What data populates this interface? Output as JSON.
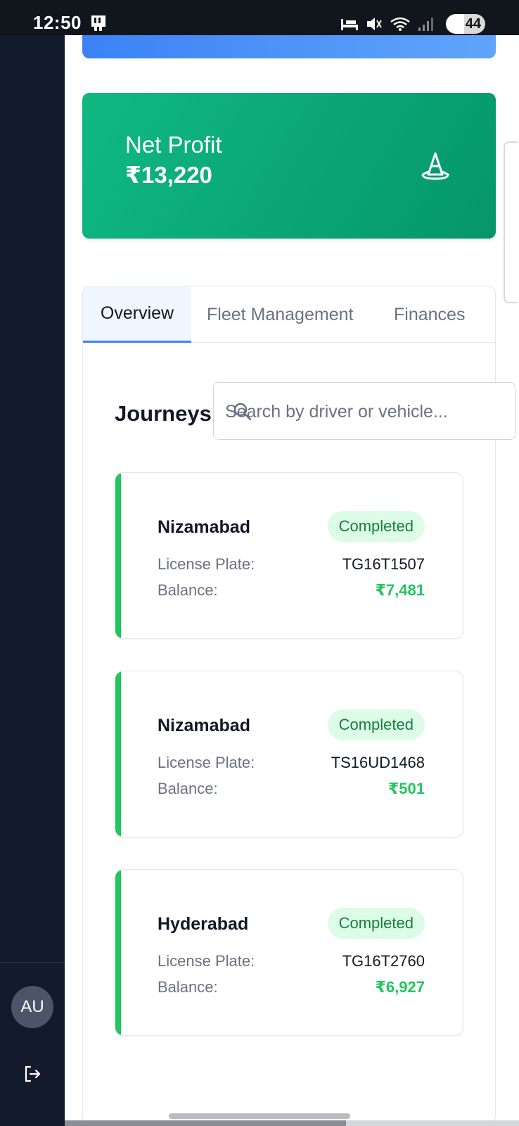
{
  "status_bar": {
    "time": "12:50",
    "battery": "44"
  },
  "sidebar": {
    "avatar_initials": "AU"
  },
  "summary": {
    "net_profit_label": "Net Profit",
    "net_profit_value": "₹13,220"
  },
  "tabs": [
    {
      "label": "Overview",
      "active": true
    },
    {
      "label": "Fleet Management",
      "active": false
    },
    {
      "label": "Finances",
      "active": false
    }
  ],
  "journeys": {
    "title": "Journeys",
    "search_placeholder": "Search by driver or vehicle...",
    "license_label": "License Plate:",
    "balance_label": "Balance:",
    "items": [
      {
        "city": "Nizamabad",
        "status": "Completed",
        "plate": "TG16T1507",
        "balance": "₹7,481"
      },
      {
        "city": "Nizamabad",
        "status": "Completed",
        "plate": "TS16UD1468",
        "balance": "₹501"
      },
      {
        "city": "Hyderabad",
        "status": "Completed",
        "plate": "TG16T2760",
        "balance": "₹6,927"
      }
    ]
  },
  "colors": {
    "sidebar": "#121a2b",
    "profit_card": "#10b981",
    "accent_blue": "#3b82f6",
    "status_green": "#22c55e"
  }
}
